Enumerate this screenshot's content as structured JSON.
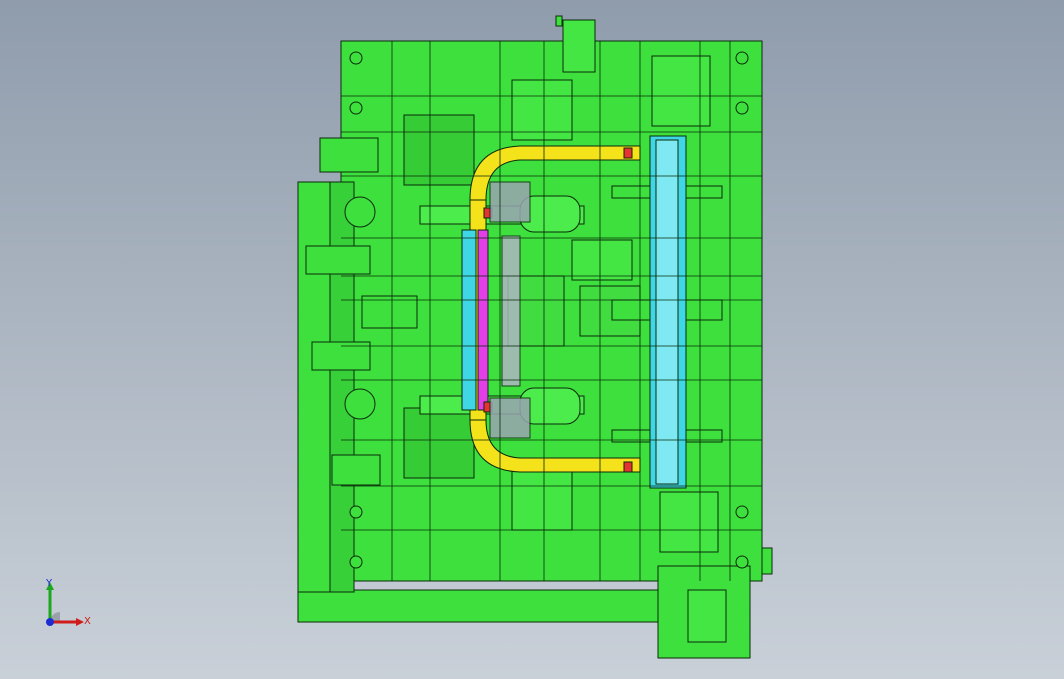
{
  "viewport": {
    "background_top": "#8f9cac",
    "background_bottom": "#c9d0d8",
    "part_color": "#3ee03e",
    "edge_color": "#0a2a0a",
    "accent_yellow": "#f4e21a",
    "accent_cyan": "#3fd7e6",
    "accent_magenta": "#e23fe6",
    "accent_red": "#e63232"
  },
  "triad": {
    "x_label": "X",
    "y_label": "Y",
    "x_color": "#d01c1c",
    "y_color": "#1ca81c",
    "z_color": "#1c2cd0"
  }
}
